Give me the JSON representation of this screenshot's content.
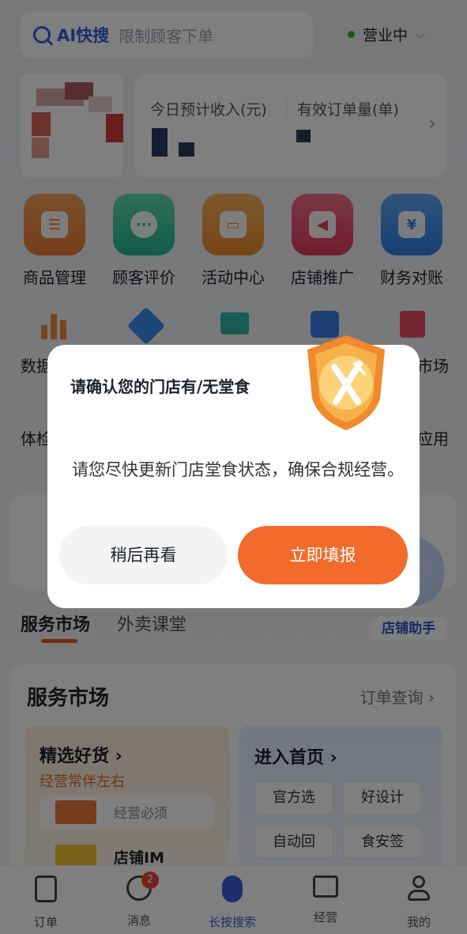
{
  "search": {
    "brand": "AI快搜",
    "placeholder": "限制顾客下单"
  },
  "store_status": "营业中",
  "income": {
    "label_income": "今日预计收入(元)",
    "label_orders": "有效订单量(单)"
  },
  "tools": [
    {
      "label": "商品管理",
      "icon": "product-icon",
      "color": "#f08a3e"
    },
    {
      "label": "顾客评价",
      "icon": "review-icon",
      "color": "#2fc39a"
    },
    {
      "label": "活动中心",
      "icon": "gift-icon",
      "color": "#f1983a"
    },
    {
      "label": "店铺推广",
      "icon": "megaphone-icon",
      "color": "#ee4d69"
    },
    {
      "label": "财务对账",
      "icon": "finance-icon",
      "color": "#3a8ef0"
    }
  ],
  "row2": {
    "left_a": "数据",
    "right_a": "市场",
    "left_b": "体检",
    "right_b": "应用"
  },
  "tabs": [
    "服务市场",
    "外卖课堂"
  ],
  "assistant_label": "店铺助手",
  "service": {
    "heading": "服务市场",
    "order_query": "订单查询",
    "card_a": {
      "title": "精选好货",
      "subtitle": "经营常伴左右",
      "row1": "经营必须",
      "row2": "店铺IM"
    },
    "card_b": {
      "title": "进入首页",
      "chips": [
        "官方选",
        "好设计",
        "自动回",
        "食安签"
      ]
    }
  },
  "nav": [
    {
      "label": "订单",
      "icon": "order-icon"
    },
    {
      "label": "消息",
      "icon": "message-icon",
      "badge": "2"
    },
    {
      "label": "长按搜索",
      "icon": "voice-search-icon"
    },
    {
      "label": "经营",
      "icon": "chart-icon"
    },
    {
      "label": "我的",
      "icon": "user-icon"
    }
  ],
  "dialog": {
    "title": "请确认您的门店有/无堂食",
    "body": "请您尽快更新门店堂食状态，确保合规经营。",
    "later_label": "稍后再看",
    "confirm_label": "立即填报"
  }
}
